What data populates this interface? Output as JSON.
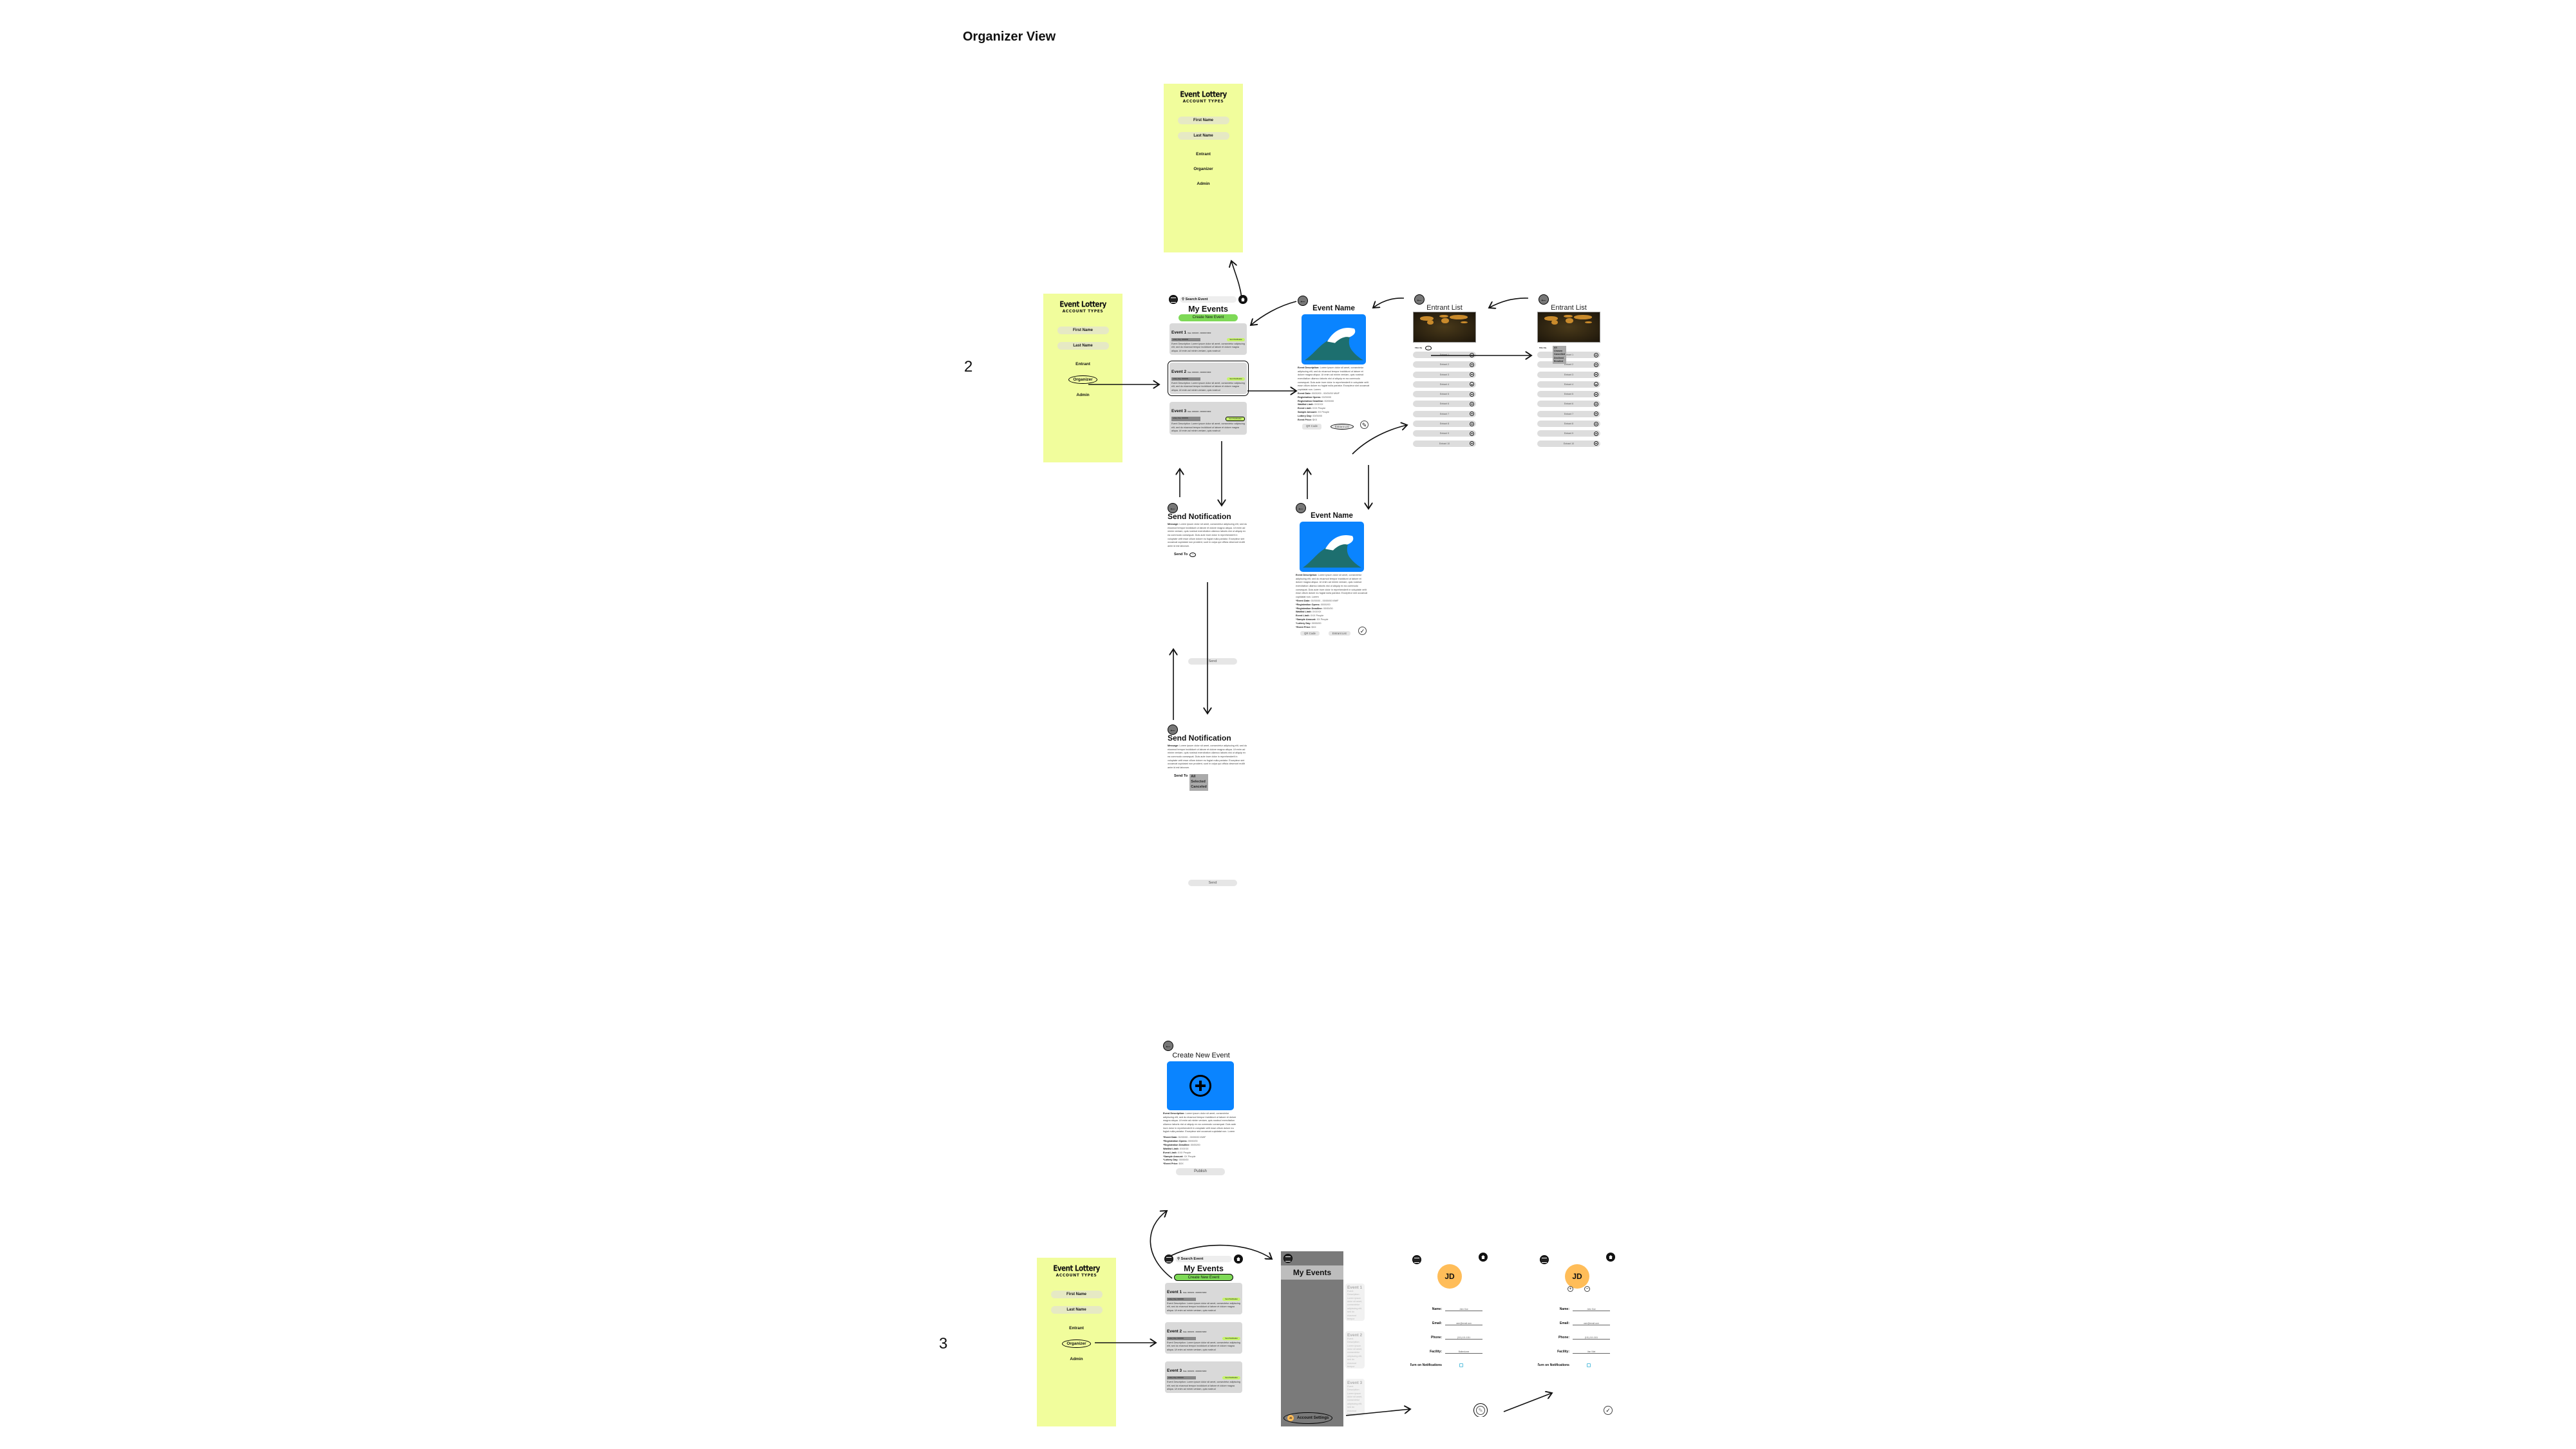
{
  "page_title": "Organizer View",
  "row_labels": [
    "2",
    "3"
  ],
  "colors": {
    "account_bg": "#f1fd9c",
    "create_button": "#7ed957",
    "notify_pill": "#c6f36b",
    "event_image": "#0a84ff",
    "avatar": "#ffbd59",
    "card": "#d9d9d9",
    "side_menu": "#7a7a7a"
  },
  "account_panel": {
    "title": "Event Lottery",
    "subtitle": "ACCOUNT TYPES",
    "first_name": "First Name",
    "last_name": "Last Name",
    "options": [
      "Entrant",
      "Organizer",
      "Admin"
    ]
  },
  "my_events": {
    "search_placeholder": "Search Event",
    "title": "My Events",
    "create_button": "Create New Event",
    "events": [
      {
        "name": "Event 1",
        "date": "Date: 00/00/00 - 00/00/00 MWF",
        "lottery": "Lottery Day: 00/00/00",
        "notify": "Send Notification",
        "description": "Event Description: Lorem ipsum dolor sit amet, consectetur adipiscing elit, sed do eiusmod tempor incididunt ut labore et dolore magna aliqua. Ut enim ad minim veniam, quis nostrud"
      },
      {
        "name": "Event 2",
        "date": "Date: 00/00/00 - 00/00/00 MWF",
        "lottery": "Lottery Day: 00/00/00",
        "notify": "Send Notification",
        "description": "Event Description: Lorem ipsum dolor sit amet, consectetur adipiscing elit, sed do eiusmod tempor incididunt ut labore et dolore magna aliqua. Ut enim ad minim veniam, quis nostrud"
      },
      {
        "name": "Event 3",
        "date": "Date: 00/00/00 - 00/00/00 MWF",
        "lottery": "Lottery Day: 00/00/00",
        "notify": "Send Notification",
        "description": "Event Description: Lorem ipsum dolor sit amet, consectetur adipiscing elit, sed do eiusmod tempor incididunt ut labore et dolore magna aliqua. Ut enim ad minim veniam, quis nostrud"
      }
    ]
  },
  "event_detail": {
    "title": "Event Name",
    "description_label": "Event Description:",
    "description": "Lorem ipsum dolor sit amet, consectetur adipiscing elit, sed do eiusmod tempor incididunt ut labore et dolore magna aliqua. Ut enim ad minim veniam, quis nostrud exercitation ullamco laboris nisi ut aliquip ex ea commodo consequat. Duis aute irure dolor in reprehenderit in voluptate velit esse cillum dolore eu fugiat nulla pariatur. Excepteur sint occaecat cupidatat non. Lorem",
    "fields": [
      {
        "label": "Event Date:",
        "value": "00/00/00 - 00/00/00 MWF"
      },
      {
        "label": "Registration Opens:",
        "value": "00/00/00"
      },
      {
        "label": "Registration Deadline:",
        "value": "00/00/00"
      },
      {
        "label": "Waitlist Limit:",
        "value": "XX/XXX"
      },
      {
        "label": "Event Limit:",
        "value": "XXX People"
      },
      {
        "label": "Sample Amount:",
        "value": "XX People"
      },
      {
        "label": "Lottery Day:",
        "value": "00/00/00"
      },
      {
        "label": "Event Price:",
        "value": "$XX"
      }
    ],
    "edit_fields": [
      {
        "label": "*Event Date:",
        "value": "00/00/00 - 00/00/00 MWF"
      },
      {
        "label": "*Registration Opens:",
        "value": "00/00/00"
      },
      {
        "label": "*Registration Deadline:",
        "value": "00/00/00"
      },
      {
        "label": "Waitlist Limit:",
        "value": "XX/XXX"
      },
      {
        "label": "Event Limit:",
        "value": "XXX People"
      },
      {
        "label": "*Sample Amount:",
        "value": "XX People"
      },
      {
        "label": "*Lottery Day:",
        "value": "00/00/00"
      },
      {
        "label": "*Event Price:",
        "value": "$XX"
      }
    ],
    "qr_button": "QR Code",
    "entrant_list_button": "Entrant List"
  },
  "entrant_list": {
    "title": "Entrant List",
    "filter_label": "Filter By",
    "filter_options": [
      "All",
      "Chosen",
      "Cancelled",
      "Declined",
      "Enrolled"
    ],
    "entrants": [
      "Entrant 1",
      "Entrant 2",
      "Entrant 3",
      "Entrant 4",
      "Entrant 5",
      "Entrant 6",
      "Entrant 7",
      "Entrant 8",
      "Entrant 9",
      "Entrant 10"
    ]
  },
  "send_notification": {
    "title": "Send Notification",
    "message_label": "Message:",
    "message": "Lorem ipsum dolor sit amet, consectetur adipiscing elit, sed do eiusmod tempor incididunt ut labore et dolore magna aliqua. Ut enim ad minim veniam, quis nostrud exercitation ullamco laboris nisi ut aliquip ex ea commodo consequat. Duis aute irure dolor in reprehenderit in voluptate velit esse cillum dolore eu fugiat nulla pariatur. Excepteur sint occaecat cupidatat non proident, sunt in culpa qui officia deserunt mollit anim id est laborum.",
    "send_to_label": "Send To",
    "send_to_options": [
      "All",
      "Selected",
      "Canceled"
    ],
    "send_button": "Send"
  },
  "create_event": {
    "title": "Create New Event",
    "publish_button": "Publish"
  },
  "side_menu": {
    "title": "My Events",
    "avatar_initials": "JD",
    "account_settings": "Account Settings"
  },
  "profile": {
    "initials": "JD",
    "fields": [
      {
        "label": "Name:",
        "value": "John Doe"
      },
      {
        "label": "Email:",
        "value": "user@email.com"
      },
      {
        "label": "Phone:",
        "value": "(111)-111-1111"
      },
      {
        "label": "Facility:",
        "value": "Butterdome"
      }
    ],
    "notifications_label": "Turn on Notifications"
  },
  "profile_edit": {
    "initials": "JD",
    "fields": [
      {
        "label": "Name:",
        "value": "John Doe"
      },
      {
        "label": "Email:",
        "value": "user@email.com"
      },
      {
        "label": "Phone:",
        "value": "(111)-111-1111"
      },
      {
        "label": "Facility:",
        "value": "Van Vliet"
      }
    ],
    "notifications_label": "Turn on Notifications"
  }
}
